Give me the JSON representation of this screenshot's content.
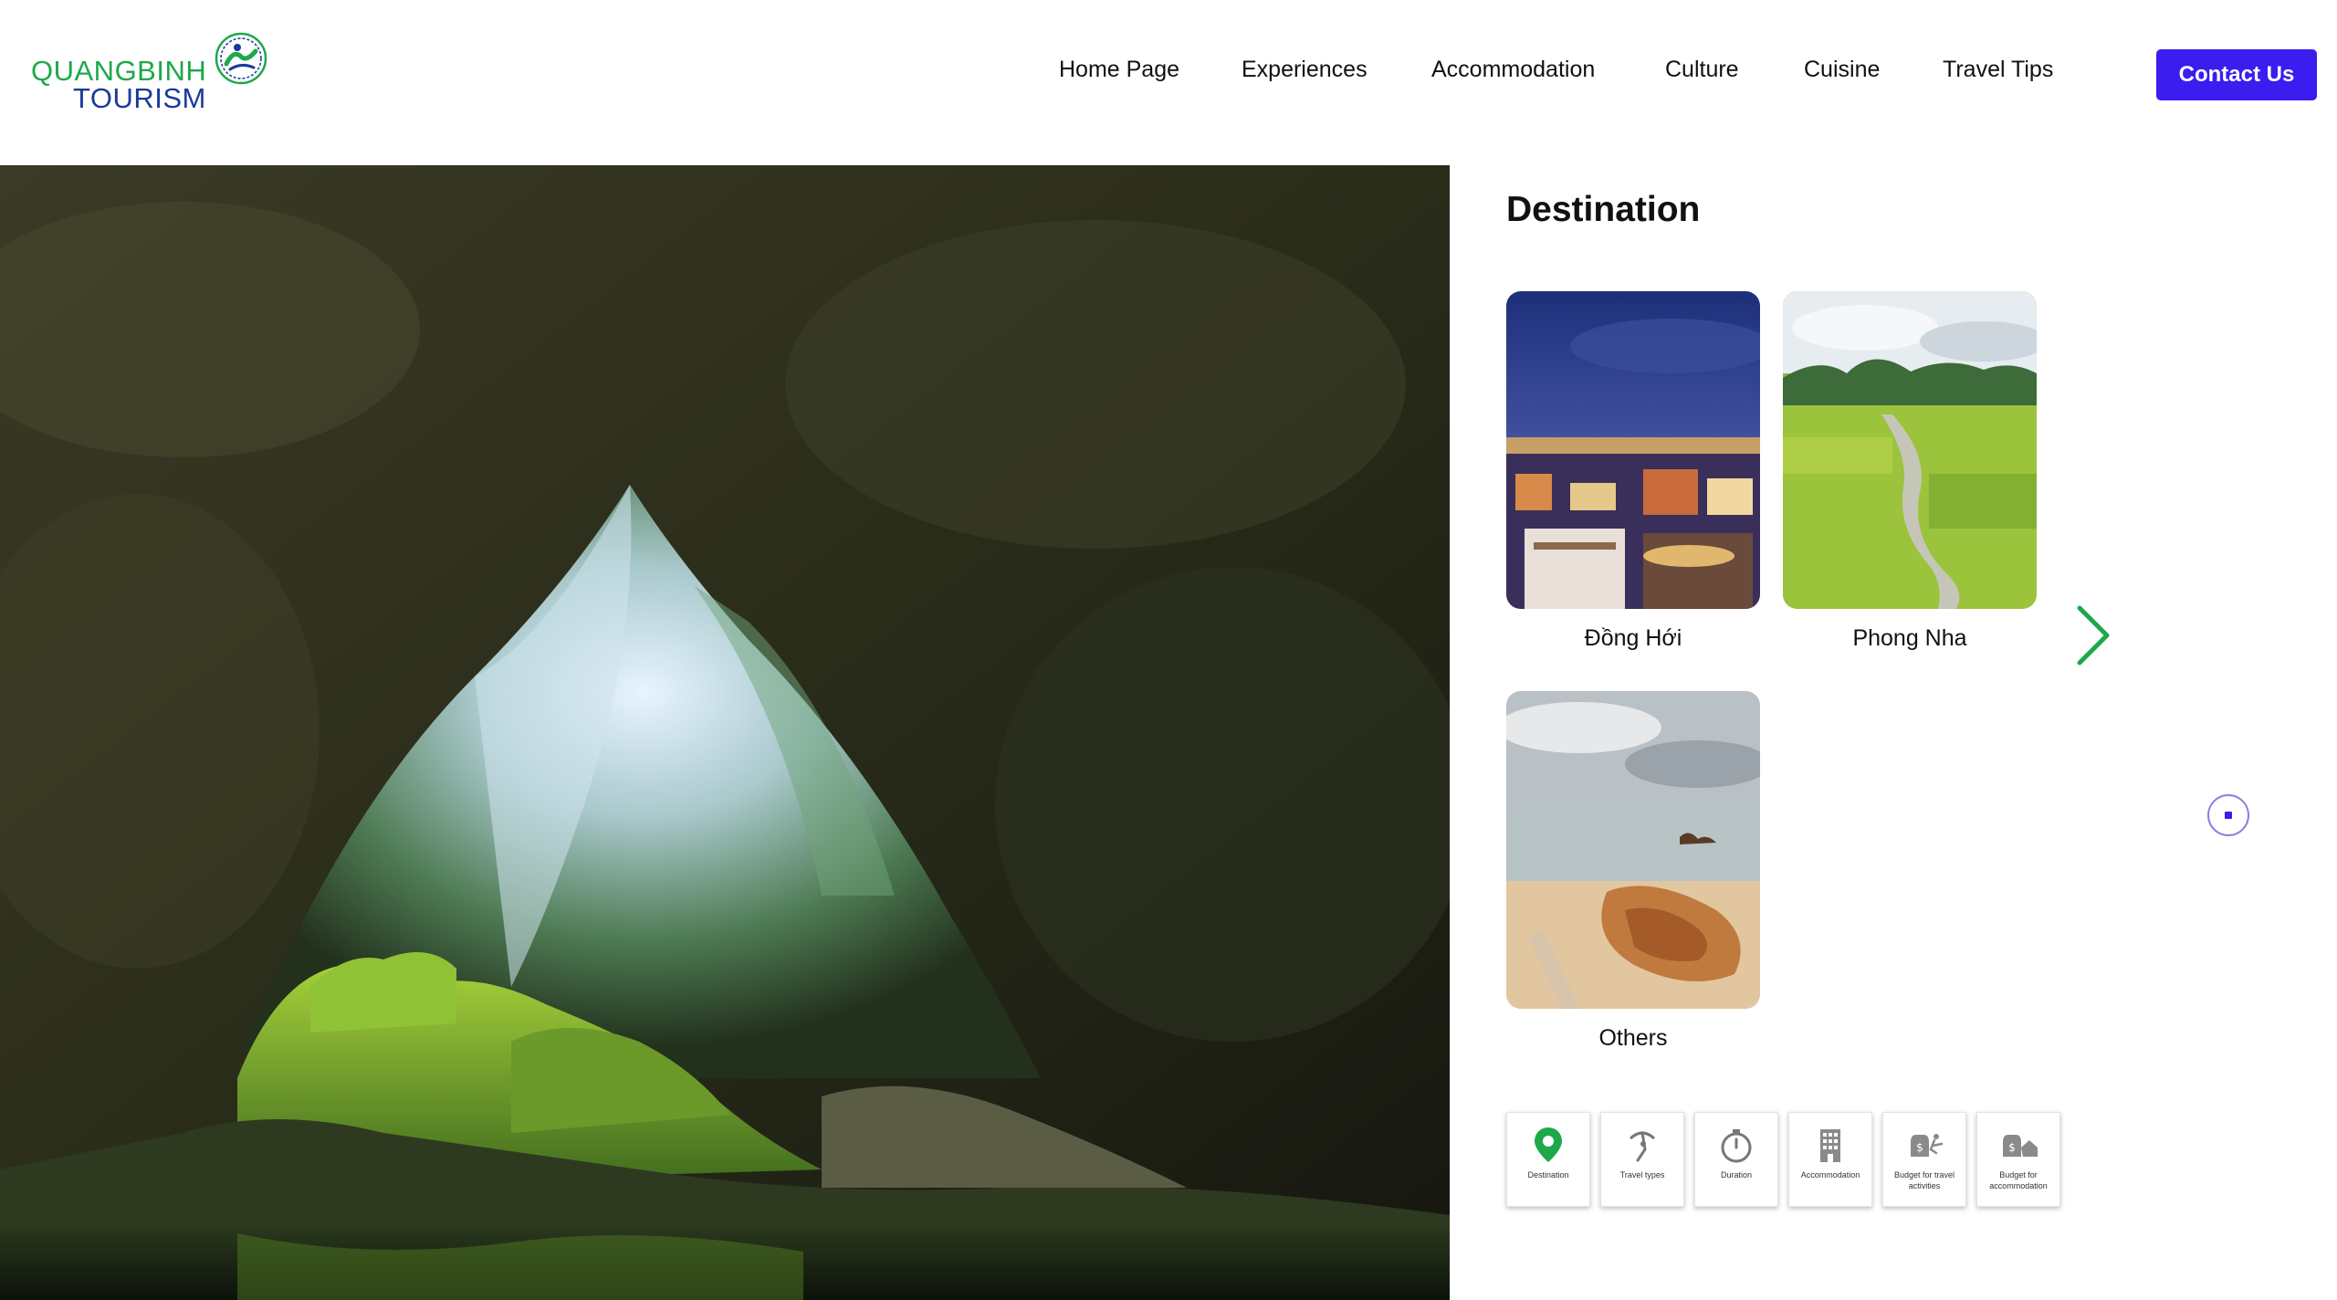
{
  "logo": {
    "line1": "QUANGBINH",
    "line2": "TOURISM"
  },
  "nav": {
    "items": [
      "Home Page",
      "Experiences",
      "Accommodation",
      "Culture",
      "Cuisine",
      "Travel Tips"
    ],
    "contact_label": "Contact Us"
  },
  "colors": {
    "accent": "#3b1df0",
    "brand_green": "#1ea84a",
    "brand_blue": "#1a3a9a",
    "arrow_green": "#1ea84a"
  },
  "panel": {
    "title": "Destination",
    "cards": [
      {
        "label": "Đồng Hới"
      },
      {
        "label": "Phong Nha"
      },
      {
        "label": "Others"
      }
    ]
  },
  "filters": [
    {
      "label": "Destination",
      "icon": "map-pin-icon"
    },
    {
      "label": "Travel types",
      "icon": "travel-types-icon"
    },
    {
      "label": "Duration",
      "icon": "stopwatch-icon"
    },
    {
      "label": "Accommodation",
      "icon": "building-icon"
    },
    {
      "label": "Budget for travel activities",
      "icon": "money-bag-activity-icon"
    },
    {
      "label": "Budget for accommodation",
      "icon": "money-bag-home-icon"
    }
  ]
}
